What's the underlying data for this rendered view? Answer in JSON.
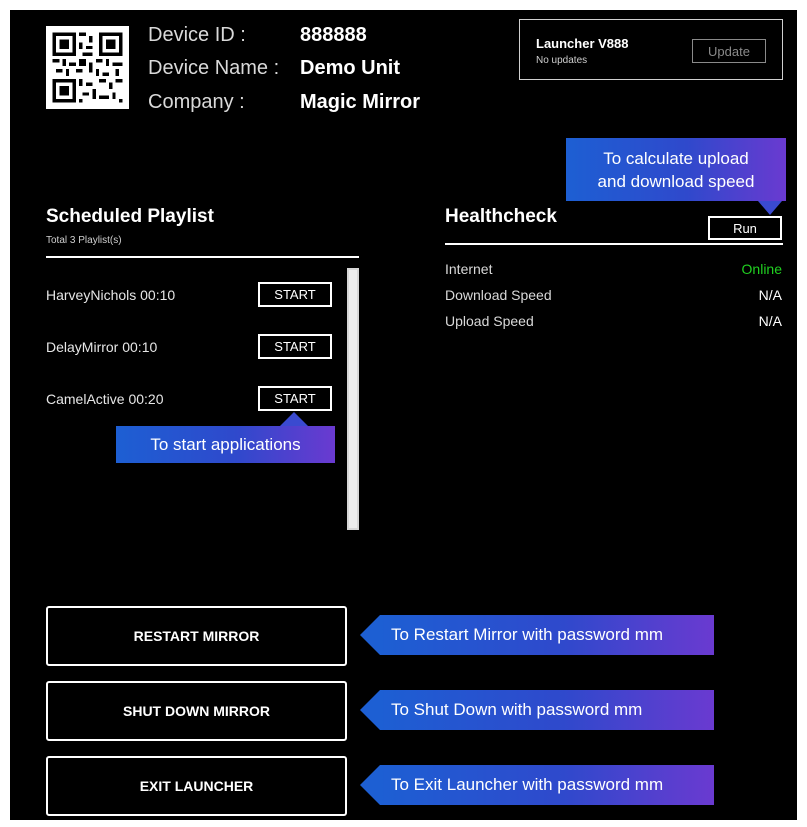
{
  "device": {
    "id_label": "Device ID :",
    "id_value": "888888",
    "name_label": "Device Name :",
    "name_value": "Demo Unit",
    "company_label": "Company :",
    "company_value": "Magic Mirror"
  },
  "launcher": {
    "title": "Launcher V888",
    "status": "No updates",
    "update_label": "Update"
  },
  "playlist": {
    "title": "Scheduled Playlist",
    "subtitle": "Total 3 Playlist(s)",
    "start_label": "START",
    "items": [
      {
        "name": "HarveyNichols  00:10"
      },
      {
        "name": "DelayMirror  00:10"
      },
      {
        "name": "CamelActive  00:20"
      }
    ]
  },
  "healthcheck": {
    "title": "Healthcheck",
    "run_label": "Run",
    "rows": [
      {
        "label": "Internet",
        "value": "Online",
        "color": "#20d020"
      },
      {
        "label": "Download Speed",
        "value": "N/A"
      },
      {
        "label": "Upload Speed",
        "value": "N/A"
      }
    ]
  },
  "actions": {
    "restart_label": "RESTART MIRROR",
    "shutdown_label": "SHUT DOWN MIRROR",
    "exit_label": "EXIT LAUNCHER"
  },
  "callouts": {
    "speed_line1": "To calculate upload",
    "speed_line2": "and download speed",
    "start": "To start applications",
    "restart": "To Restart Mirror with password mm",
    "shutdown": "To Shut Down with password mm",
    "exit": "To Exit Launcher with password mm"
  },
  "colors": {
    "background": "#000000",
    "online": "#20d020",
    "callout_blue": "#1d5fd3",
    "callout_purple": "#6a3ad0"
  },
  "icons": {
    "qr": "qr-code-icon"
  }
}
